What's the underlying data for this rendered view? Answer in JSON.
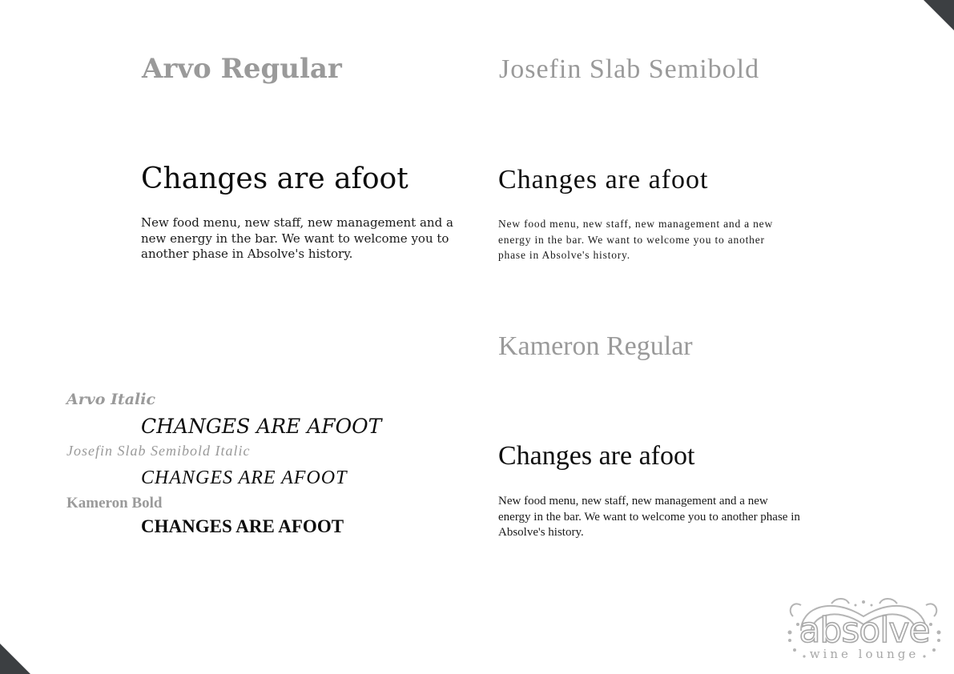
{
  "colors": {
    "corner": "#3c3f42",
    "label": "#9a9a9a",
    "text": "#111111",
    "logo": "#a8a8a8"
  },
  "specimens": {
    "arvo": {
      "label": "Arvo Regular",
      "headline": "Changes are afoot",
      "body": "New food menu, new staff, new management and a new energy in the bar. We want to welcome you to another phase in Absolve's history."
    },
    "josefin": {
      "label": "Josefin Slab Semibold",
      "headline": "Changes are afoot",
      "body": "New food menu, new staff, new management and a new energy in the bar. We want to welcome you to another phase in Absolve's history."
    },
    "kameron": {
      "label": "Kameron Regular",
      "headline": "Changes are afoot",
      "body": "New food menu, new staff, new management and a new energy in the bar. We want to welcome you to another phase in Absolve's history."
    }
  },
  "variants": [
    {
      "label": "Arvo Italic",
      "sample": "CHANGES ARE AFOOT"
    },
    {
      "label": "Josefin Slab Semibold Italic",
      "sample": "CHANGES  ARE  AFOOT"
    },
    {
      "label": "Kameron Bold",
      "sample": "CHANGES ARE AFOOT"
    }
  ],
  "logo": {
    "wordmark": "absolve",
    "tagline": "wine lounge",
    "icon": "ornament-swirl-icon"
  }
}
